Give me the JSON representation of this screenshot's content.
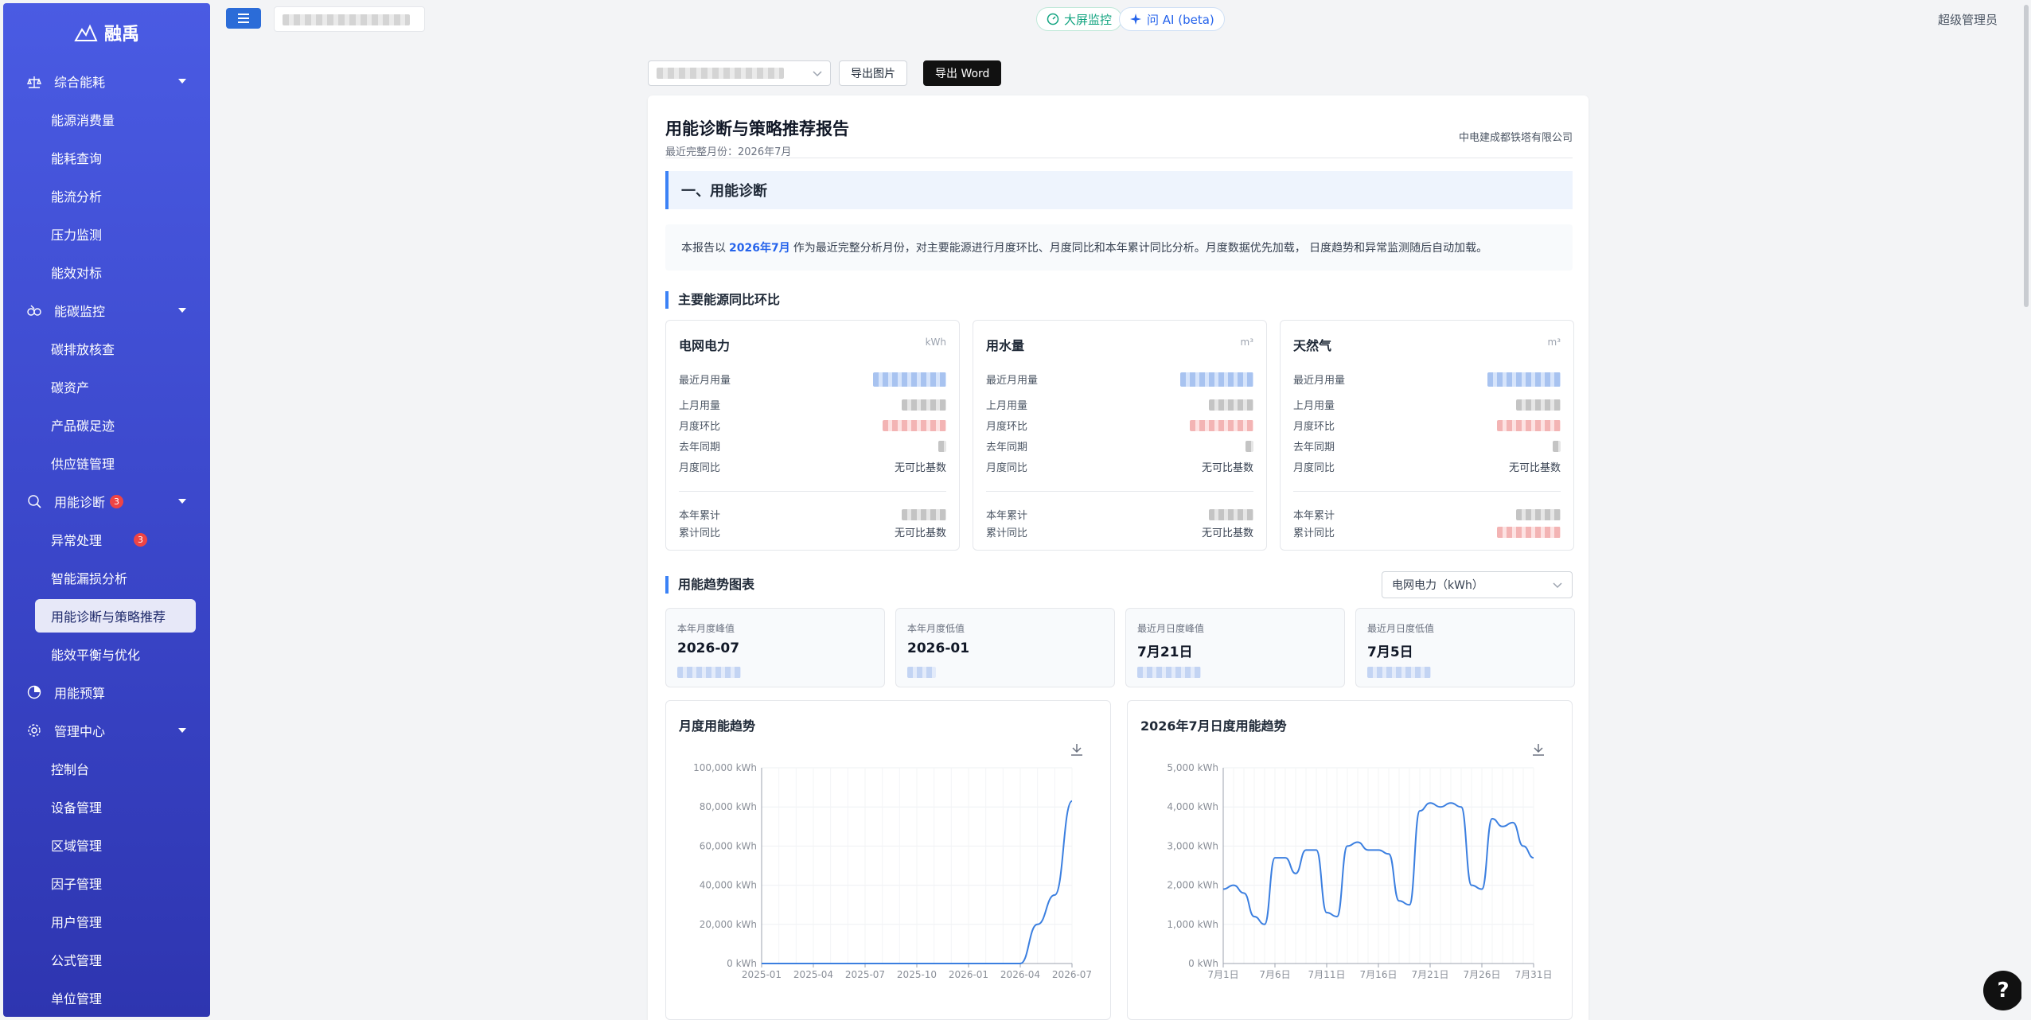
{
  "app": {
    "name": "融禹"
  },
  "sidebar": {
    "groups": [
      {
        "label": "综合能耗",
        "icon": "scale-icon",
        "items": [
          "能源消费量",
          "能耗查询",
          "能流分析",
          "压力监测",
          "能效对标"
        ]
      },
      {
        "label": "能碳监控",
        "icon": "carbon-icon",
        "items": [
          "碳排放核查",
          "碳资产",
          "产品碳足迹",
          "供应链管理"
        ]
      },
      {
        "label": "用能诊断",
        "icon": "diagnose-icon",
        "badge": "3",
        "items": [
          "异常处理",
          "智能漏损分析",
          "用能诊断与策略推荐",
          "能效平衡与优化"
        ],
        "item_badge": "3"
      },
      {
        "label": "用能预算",
        "icon": "budget-icon",
        "items": []
      },
      {
        "label": "管理中心",
        "icon": "settings-icon",
        "items": [
          "控制台",
          "设备管理",
          "区域管理",
          "因子管理",
          "用户管理",
          "公式管理",
          "单位管理"
        ]
      }
    ],
    "active_item": "用能诊断与策略推荐"
  },
  "topbar": {
    "bigscreen_label": "大屏监控",
    "ai_label": "问 AI (beta)",
    "user_label": "超级管理员"
  },
  "toolbar": {
    "export_image": "导出图片",
    "export_word": "导出 Word"
  },
  "report": {
    "title": "用能诊断与策略推荐报告",
    "subtitle": "最近完整月份：2026年7月",
    "org": "中电建成都铁塔有限公司",
    "section1_title": "一、用能诊断",
    "intro_before": "本报告以",
    "intro_highlight": "2026年7月",
    "intro_after": "作为最近完整分析月份，对主要能源进行月度环比、月度同比和本年累计同比分析。月度数据优先加载， 日度趋势和异常监测随后自动加载。",
    "compare_title": "主要能源同比环比",
    "cards": [
      {
        "name": "电网电力",
        "unit": "kWh",
        "yoy": "无可比基数",
        "cum_yoy": "无可比基数"
      },
      {
        "name": "用水量",
        "unit": "m³",
        "yoy": "无可比基数",
        "cum_yoy": "无可比基数"
      },
      {
        "name": "天然气",
        "unit": "m³",
        "yoy": "无可比基数",
        "cum_yoy": ""
      }
    ],
    "labels": {
      "recent": "最近月用量",
      "last": "上月用量",
      "mom": "月度环比",
      "last_year": "去年同期",
      "yoy": "月度同比",
      "cum": "本年累计",
      "cum_yoy": "累计同比"
    },
    "trend_title": "用能趋势图表",
    "trend_select": "电网电力（kWh）",
    "stats": [
      {
        "label": "本年月度峰值",
        "value": "2026-07"
      },
      {
        "label": "本年月度低值",
        "value": "2026-01"
      },
      {
        "label": "最近月日度峰值",
        "value": "7月21日"
      },
      {
        "label": "最近月日度低值",
        "value": "7月5日"
      }
    ],
    "monthly_chart_title": "月度用能趋势",
    "daily_chart_title": "2026年7月日度用能趋势"
  },
  "chart_data": [
    {
      "type": "line",
      "title": "月度用能趋势",
      "x": [
        "2025-01",
        "2025-02",
        "2025-03",
        "2025-04",
        "2025-05",
        "2025-06",
        "2025-07",
        "2025-08",
        "2025-09",
        "2025-10",
        "2025-11",
        "2025-12",
        "2026-01",
        "2026-02",
        "2026-03",
        "2026-04",
        "2026-05",
        "2026-06",
        "2026-07"
      ],
      "xticks": [
        "2025-01",
        "2025-04",
        "2025-07",
        "2025-10",
        "2026-01",
        "2026-04",
        "2026-07"
      ],
      "values": [
        0,
        0,
        0,
        0,
        0,
        0,
        0,
        0,
        0,
        0,
        0,
        0,
        0,
        0,
        0,
        0,
        20000,
        35000,
        83000
      ],
      "ylim": [
        0,
        100000
      ],
      "yticks": [
        "0 kWh",
        "20,000 kWh",
        "40,000 kWh",
        "60,000 kWh",
        "80,000 kWh",
        "100,000 kWh"
      ],
      "color": "#3b7fe0",
      "grid": true
    },
    {
      "type": "line",
      "title": "2026年7月日度用能趋势",
      "x": [
        "7月1日",
        "7月2日",
        "7月3日",
        "7月4日",
        "7月5日",
        "7月6日",
        "7月7日",
        "7月8日",
        "7月9日",
        "7月10日",
        "7月11日",
        "7月12日",
        "7月13日",
        "7月14日",
        "7月15日",
        "7月16日",
        "7月17日",
        "7月18日",
        "7月19日",
        "7月20日",
        "7月21日",
        "7月22日",
        "7月23日",
        "7月24日",
        "7月25日",
        "7月26日",
        "7月27日",
        "7月28日",
        "7月29日",
        "7月30日",
        "7月31日"
      ],
      "xticks": [
        "7月1日",
        "7月6日",
        "7月11日",
        "7月16日",
        "7月21日",
        "7月26日",
        "7月31日"
      ],
      "values": [
        1900,
        2000,
        1800,
        1200,
        1000,
        2700,
        2700,
        2300,
        2900,
        2900,
        1300,
        1200,
        3000,
        3100,
        2900,
        2900,
        2800,
        1600,
        1500,
        3900,
        4100,
        4000,
        4100,
        4000,
        2000,
        1900,
        3700,
        3500,
        3600,
        3000,
        2700
      ],
      "ylim": [
        0,
        5000
      ],
      "yticks": [
        "0 kWh",
        "1,000 kWh",
        "2,000 kWh",
        "3,000 kWh",
        "4,000 kWh",
        "5,000 kWh"
      ],
      "color": "#3b7fe0",
      "grid": true
    }
  ]
}
